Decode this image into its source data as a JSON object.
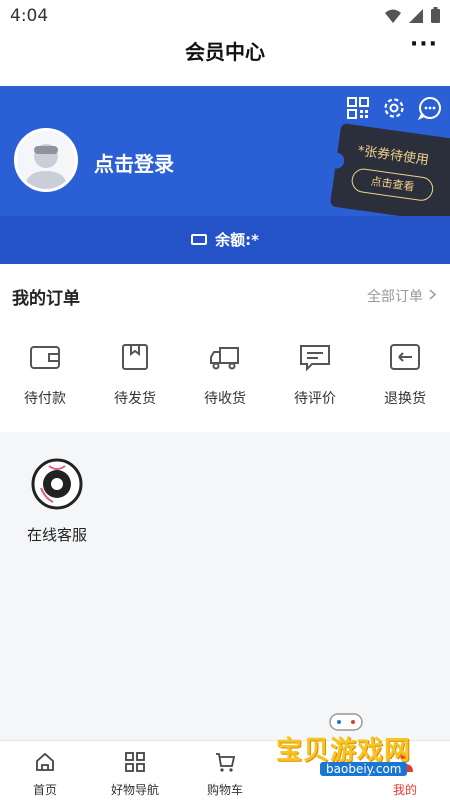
{
  "status": {
    "time": "4:04"
  },
  "titlebar": {
    "title": "会员中心",
    "more": "···"
  },
  "profile": {
    "login_text": "点击登录",
    "coupon_text": "*张券待使用",
    "coupon_button": "点击查看",
    "balance": "余额:*"
  },
  "orders": {
    "title": "我的订单",
    "all_label": "全部订单",
    "items": [
      {
        "label": "待付款",
        "icon": "wallet-icon"
      },
      {
        "label": "待发货",
        "icon": "box-icon"
      },
      {
        "label": "待收货",
        "icon": "truck-icon"
      },
      {
        "label": "待评价",
        "icon": "comment-icon"
      },
      {
        "label": "退换货",
        "icon": "return-icon"
      }
    ]
  },
  "service": {
    "label": "在线客服"
  },
  "nav": {
    "items": [
      {
        "label": "首页",
        "icon": "home-icon"
      },
      {
        "label": "好物导航",
        "icon": "grid-icon"
      },
      {
        "label": "购物车",
        "icon": "cart-icon"
      },
      {
        "label": "",
        "icon": ""
      },
      {
        "label": "我的",
        "icon": "user-icon"
      }
    ]
  },
  "watermark": {
    "text": "宝贝游戏网",
    "url": "baobeiy.com"
  },
  "colors": {
    "brand_blue": "#2a5fd6",
    "active_red": "#e53935"
  }
}
